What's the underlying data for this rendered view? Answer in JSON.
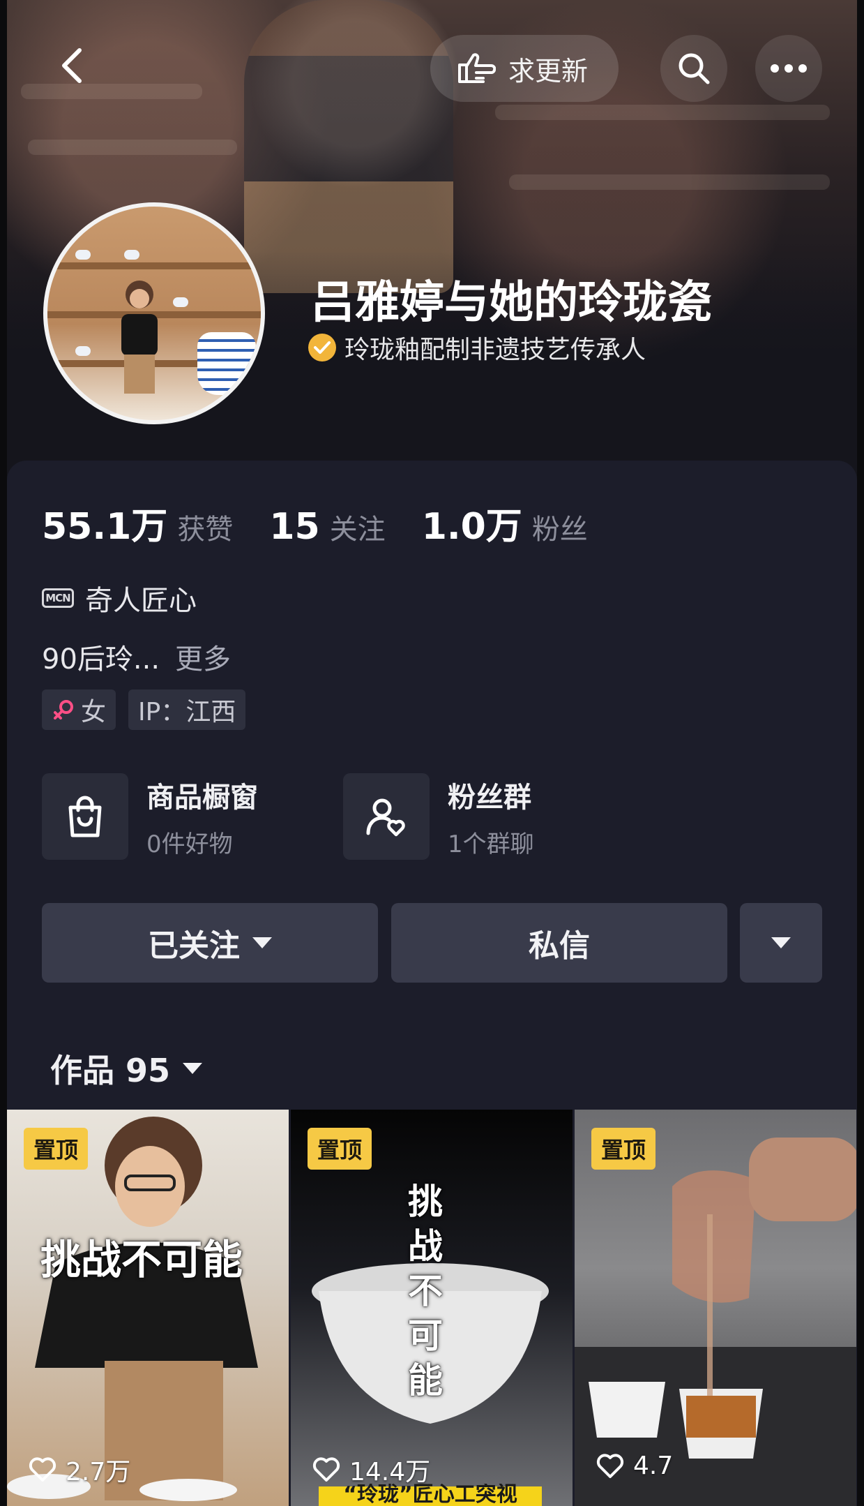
{
  "header": {
    "update_label": "求更新"
  },
  "profile": {
    "name": "吕雅婷与她的玲珑瓷",
    "verification": "玲珑釉配制非遗技艺传承人"
  },
  "stats": [
    {
      "value": "55.1万",
      "label": "获赞"
    },
    {
      "value": "15",
      "label": "关注"
    },
    {
      "value": "1.0万",
      "label": "粉丝"
    }
  ],
  "mcn": {
    "badge": "MCN",
    "name": "奇人匠心"
  },
  "bio": {
    "text": "90后玲...",
    "more": "更多"
  },
  "tags": {
    "gender": "女",
    "ip": "IP：江西"
  },
  "features": {
    "shop": {
      "title": "商品橱窗",
      "sub": "0件好物"
    },
    "fans": {
      "title": "粉丝群",
      "sub": "1个群聊"
    }
  },
  "actions": {
    "follow": "已关注",
    "message": "私信"
  },
  "works": {
    "label": "作品 95"
  },
  "videos": [
    {
      "pin": "置顶",
      "overlay": "挑战不可能",
      "likes": "2.7万"
    },
    {
      "pin": "置顶",
      "overlay": "挑战不可能",
      "likes": "14.4万",
      "bottom_caption": "“玲珑”匠心工突视"
    },
    {
      "pin": "置顶",
      "overlay": "",
      "likes": "4.7"
    }
  ],
  "colors": {
    "pin_yellow": "#f6c945",
    "verify_badge": "#f2b53a",
    "card_bg": "#1c1d2a"
  }
}
